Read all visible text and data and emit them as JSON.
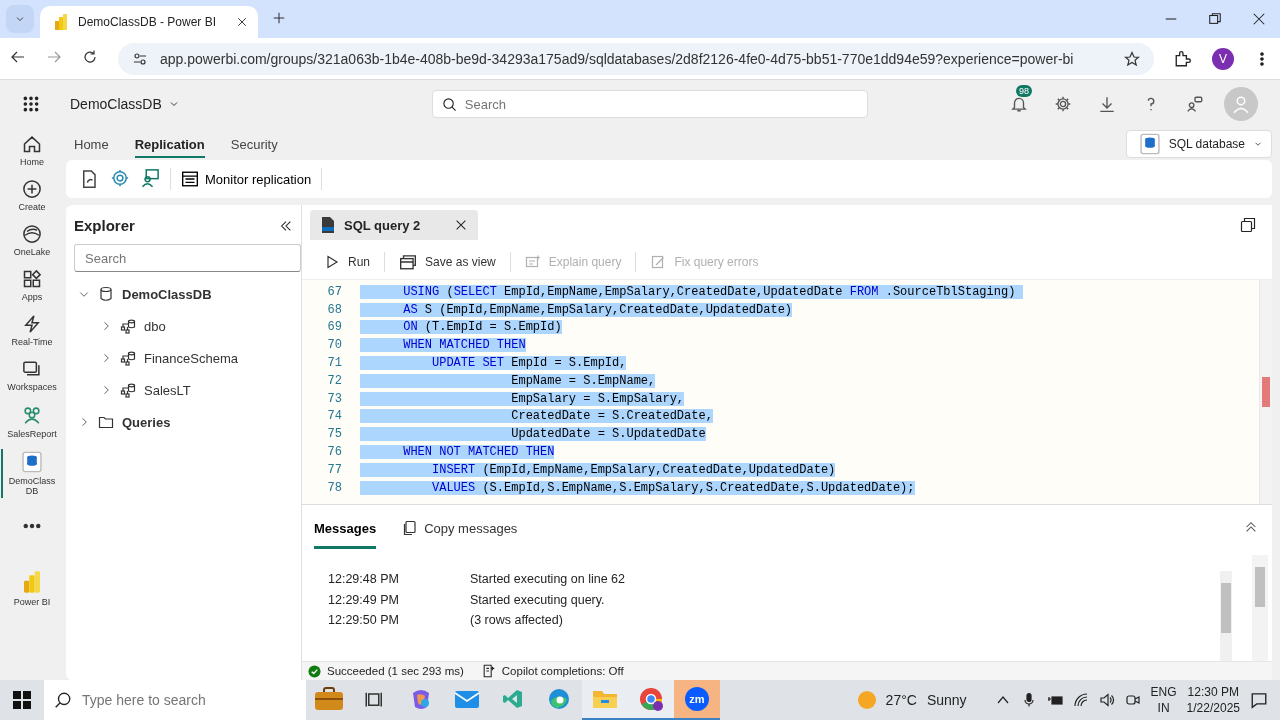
{
  "browser": {
    "tab_title": "DemoClassDB - Power BI",
    "url": "app.powerbi.com/groups/321a063b-1b4e-408b-be9d-34293a175ad9/sqldatabases/2d8f2126-4fe0-4d75-bb51-770e1dd94e59?experience=power-bi",
    "profile_initial": "V"
  },
  "header": {
    "workspace": "DemoClassDB",
    "search_placeholder": "Search",
    "notification_count": "98"
  },
  "rail": [
    {
      "label": "Home",
      "kind": "home",
      "selected": false
    },
    {
      "label": "Create",
      "kind": "create",
      "selected": false
    },
    {
      "label": "OneLake",
      "kind": "onelake",
      "selected": false
    },
    {
      "label": "Apps",
      "kind": "apps",
      "selected": false
    },
    {
      "label": "Real-Time",
      "kind": "realtime",
      "selected": false
    },
    {
      "label": "Workspaces",
      "kind": "workspaces",
      "selected": false
    },
    {
      "label": "SalesReport",
      "kind": "app",
      "selected": false
    },
    {
      "label": "DemoClass DB",
      "kind": "sqldb",
      "selected": true
    },
    {
      "kind": "more",
      "selected": false
    },
    {
      "label": "Power BI",
      "kind": "powerbi",
      "selected": false
    }
  ],
  "ribbon": {
    "tabs": [
      {
        "label": "Home",
        "selected": false
      },
      {
        "label": "Replication",
        "selected": true
      },
      {
        "label": "Security",
        "selected": false
      }
    ],
    "mode": "SQL database",
    "monitor": "Monitor replication"
  },
  "explorer": {
    "title": "Explorer",
    "search_placeholder": "Search",
    "tree": [
      {
        "label": "DemoClassDB",
        "kind": "database",
        "expanded": true,
        "children": [
          {
            "label": "dbo",
            "kind": "schema",
            "expanded": false
          },
          {
            "label": "FinanceSchema",
            "kind": "schema",
            "expanded": false
          },
          {
            "label": "SalesLT",
            "kind": "schema",
            "expanded": false
          }
        ]
      },
      {
        "label": "Queries",
        "kind": "folder",
        "expanded": false
      }
    ]
  },
  "editor": {
    "tab": "SQL query 2",
    "toolbar": [
      {
        "label": "Run",
        "kind": "run",
        "disabled": false
      },
      {
        "label": "Save as view",
        "kind": "view",
        "disabled": false
      },
      {
        "label": "Explain query",
        "kind": "explain",
        "disabled": true
      },
      {
        "label": "Fix query errors",
        "kind": "fix",
        "disabled": true
      }
    ],
    "lines": [
      {
        "number": "67",
        "selected": true,
        "tokens": [
          {
            "text": "      USING",
            "kind": "keyword"
          },
          {
            "text": " ("
          },
          {
            "text": "SELECT",
            "kind": "keyword"
          },
          {
            "text": " EmpId,EmpName,EmpSalary,CreatedDate,UpdatedDate "
          },
          {
            "text": "FROM",
            "kind": "keyword"
          },
          {
            "text": " .SourceTblStaging) "
          }
        ]
      },
      {
        "number": "68",
        "selected": true,
        "tokens": [
          {
            "text": "      AS",
            "kind": "keyword"
          },
          {
            "text": " S (EmpId,EmpName,EmpSalary,CreatedDate,UpdatedDate)"
          }
        ]
      },
      {
        "number": "69",
        "selected": true,
        "tokens": [
          {
            "text": "      ON",
            "kind": "keyword"
          },
          {
            "text": " (T.EmpId = S.EmpId)"
          }
        ]
      },
      {
        "number": "70",
        "selected": true,
        "tokens": [
          {
            "text": "      WHEN MATCHED THEN",
            "kind": "keyword"
          }
        ]
      },
      {
        "number": "71",
        "selected": true,
        "tokens": [
          {
            "text": "          UPDATE SET",
            "kind": "keyword"
          },
          {
            "text": " EmpId = S.EmpId,"
          }
        ]
      },
      {
        "number": "72",
        "selected": true,
        "tokens": [
          {
            "text": "                     EmpName = S.EmpName,"
          }
        ]
      },
      {
        "number": "73",
        "selected": true,
        "tokens": [
          {
            "text": "                     EmpSalary = S.EmpSalary,"
          }
        ]
      },
      {
        "number": "74",
        "selected": true,
        "tokens": [
          {
            "text": "                     CreatedDate = S.CreatedDate,"
          }
        ]
      },
      {
        "number": "75",
        "selected": true,
        "tokens": [
          {
            "text": "                     UpdatedDate = S.UpdatedDate"
          }
        ]
      },
      {
        "number": "76",
        "selected": true,
        "tokens": [
          {
            "text": "      WHEN NOT MATCHED THEN",
            "kind": "keyword"
          }
        ]
      },
      {
        "number": "77",
        "selected": true,
        "tokens": [
          {
            "text": "          INSERT",
            "kind": "keyword"
          },
          {
            "text": " (EmpId,EmpName,EmpSalary,CreatedDate,UpdatedDate)"
          }
        ]
      },
      {
        "number": "78",
        "selected": true,
        "tokens": [
          {
            "text": "          VALUES",
            "kind": "keyword"
          },
          {
            "text": " (S.EmpId,S.EmpName,S.EmpSalary,S.CreatedDate,S.UpdatedDate);"
          }
        ]
      }
    ]
  },
  "messages": {
    "tab": "Messages",
    "copy_button": "Copy messages",
    "rows": [
      {
        "time": "12:29:48 PM",
        "text": "Started executing on line 62"
      },
      {
        "time": "12:29:49 PM",
        "text": "Started executing query."
      },
      {
        "time": "12:29:50 PM",
        "text": "(3 rows affected)"
      }
    ]
  },
  "status": {
    "result": "Succeeded (1 sec 293 ms)",
    "copilot": "Copilot completions: Off"
  },
  "taskbar": {
    "search_placeholder": "Type here to search",
    "apps": [
      {
        "kind": "briefcase",
        "running": false
      },
      {
        "kind": "taskview",
        "running": false
      },
      {
        "kind": "copilot",
        "running": false
      },
      {
        "kind": "mail",
        "running": false
      },
      {
        "kind": "vscode",
        "running": false
      },
      {
        "kind": "edge",
        "running": false
      },
      {
        "kind": "files",
        "running": true
      },
      {
        "kind": "chrome",
        "running": true
      },
      {
        "kind": "zoom",
        "running": true,
        "label": "zm"
      }
    ],
    "temperature": "27°C",
    "condition": "Sunny",
    "language": "ENG",
    "region": "IN",
    "time": "12:30 PM",
    "date": "1/22/2025"
  }
}
